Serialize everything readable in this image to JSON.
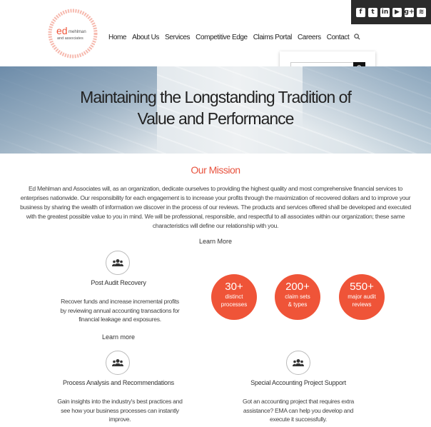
{
  "social": {
    "icons": [
      "facebook-icon",
      "twitter-icon",
      "linkedin-icon",
      "youtube-icon",
      "google-plus-icon",
      "rss-icon"
    ],
    "glyphs": [
      "f",
      "t",
      "in",
      "▶",
      "g+",
      "≋"
    ]
  },
  "logo": {
    "main": "ed",
    "line1": "mehlman",
    "line2": "and associates",
    "ring_color": "#ef5438"
  },
  "nav": {
    "items": [
      "Home",
      "About Us",
      "Services",
      "Competitive Edge",
      "Claims Portal",
      "Careers",
      "Contact"
    ],
    "search_icon": "search-icon"
  },
  "search": {
    "placeholder": "",
    "button_icon": "search-icon"
  },
  "hero": {
    "line1": "Maintaining the Longstanding Tradition of",
    "line2": "Value and Performance"
  },
  "mission": {
    "title": "Our Mission",
    "text": "Ed Mehlman and Associates will, as an organization, dedicate ourselves to providing the highest quality and most comprehensive financial services to enterprises nationwide. Our responsibility for each engagement is to increase your profits through the maximization of recovered dollars and to improve your business by sharing the wealth of information we discover in the process of our reviews. The products and services offered shall be developed and executed with the greatest possible value to you in mind. We will be professional, responsible, and respectful to all associates within our organization; these same characteristics will define our relationship with you.",
    "learn_more": "Learn More"
  },
  "services": [
    {
      "title": "Post Audit Recovery",
      "desc": "Recover funds and increase incremental profits by reviewing annual accounting transactions for financial leakage and exposures.",
      "link": "Learn more"
    },
    {
      "title": "Process Analysis and Recommendations",
      "desc": "Gain insights into the industry's best practices and see how your business processes can instantly improve.",
      "link": ""
    },
    {
      "title": "Special Accounting Project Support",
      "desc": "Got an accounting project that requires extra assistance? EMA can help you develop and execute it successfully.",
      "link": ""
    }
  ],
  "stats": [
    {
      "number": "30+",
      "line1": "distinct",
      "line2": "processes"
    },
    {
      "number": "200+",
      "line1": "claim sets",
      "line2": "& types"
    },
    {
      "number": "550+",
      "line1": "major audit",
      "line2": "reviews"
    }
  ],
  "colors": {
    "accent": "#ef5438",
    "dark_bar": "#2b2b2b"
  }
}
